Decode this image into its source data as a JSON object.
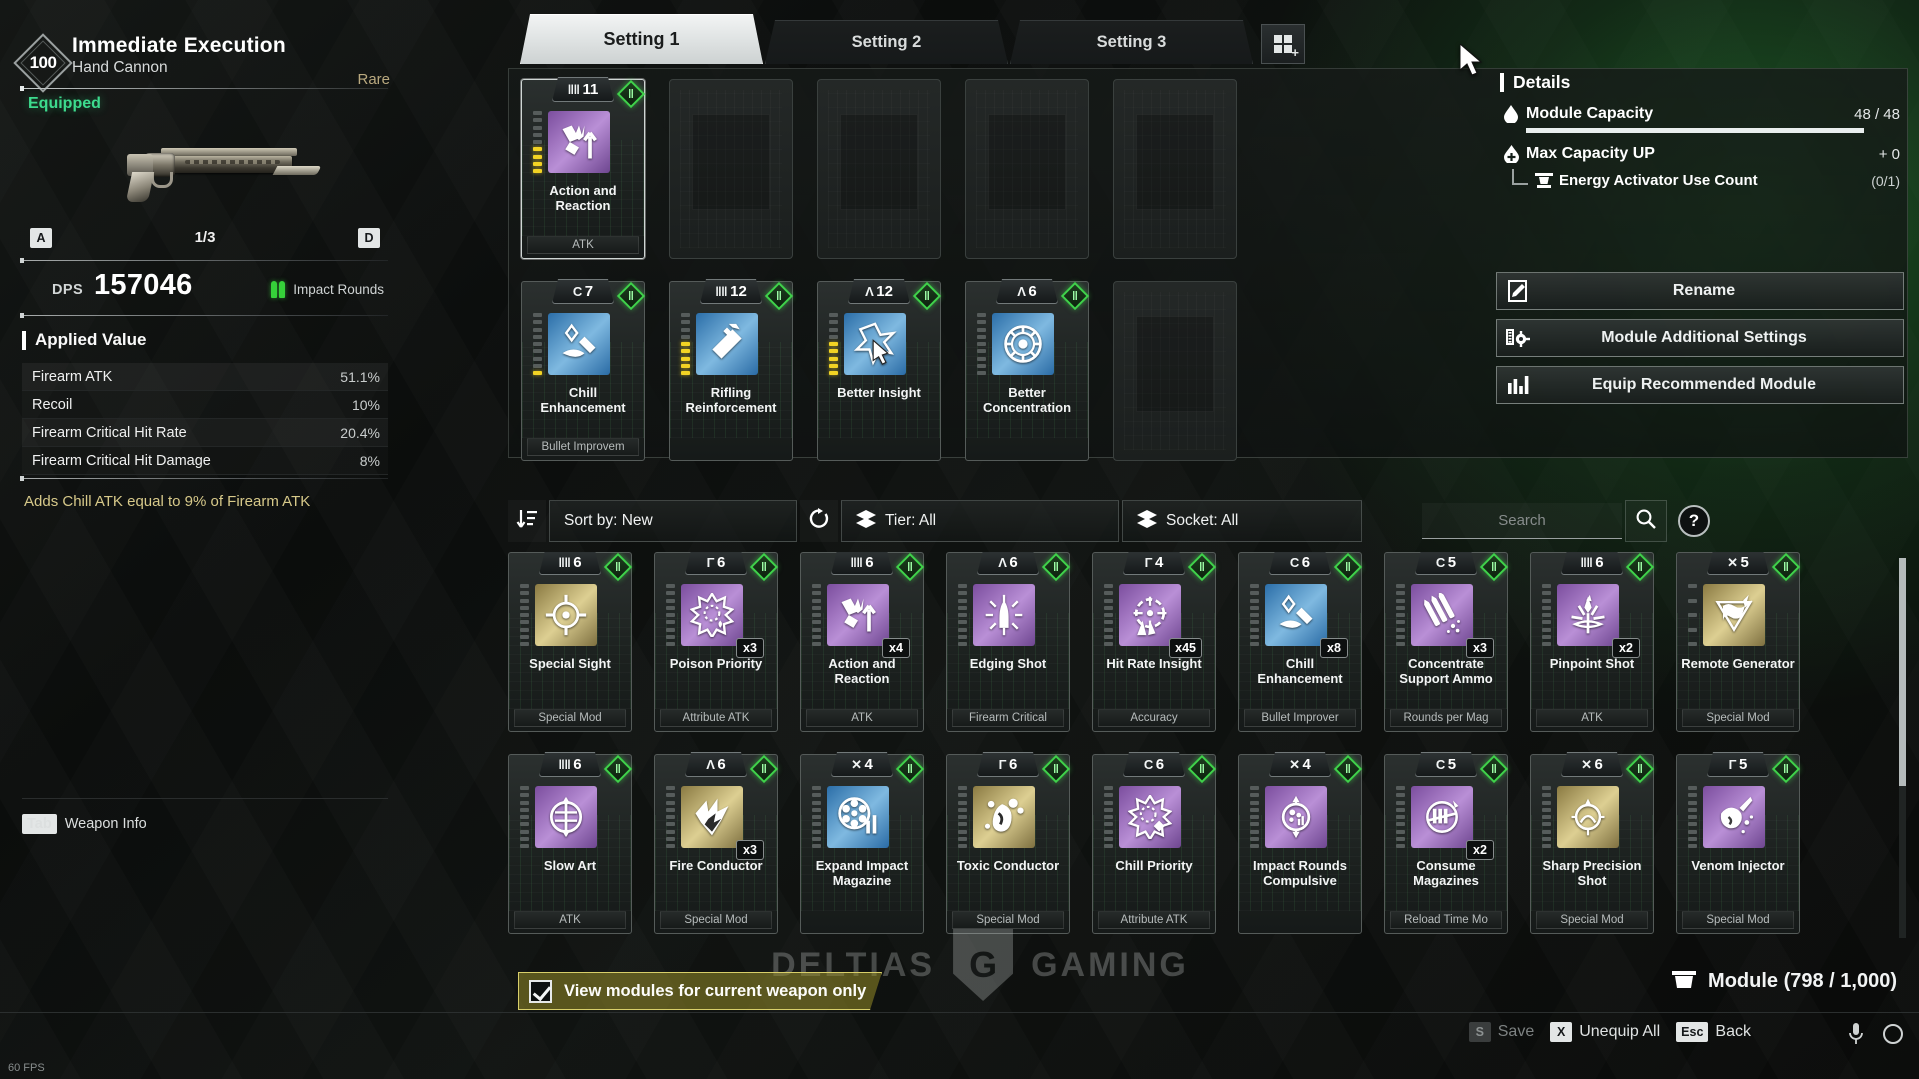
{
  "weapon": {
    "level": "100",
    "name": "Immediate Execution",
    "type": "Hand Cannon",
    "rarity": "Rare",
    "status": "Equipped",
    "page": "1/3",
    "prev_key": "A",
    "next_key": "D",
    "dps_label": "DPS",
    "dps_value": "157046",
    "ammo_type": "Impact Rounds",
    "applied_value_title": "Applied Value",
    "stats": [
      {
        "name": "Firearm ATK",
        "value": "51.1%"
      },
      {
        "name": "Recoil",
        "value": "10%"
      },
      {
        "name": "Firearm Critical Hit Rate",
        "value": "20.4%"
      },
      {
        "name": "Firearm Critical Hit Damage",
        "value": "8%"
      }
    ],
    "effect": "Adds Chill ATK equal to 9% of Firearm ATK",
    "weapon_info_key": "Tab",
    "weapon_info_label": "Weapon Info"
  },
  "tabs": [
    {
      "label": "Setting 1",
      "active": true
    },
    {
      "label": "Setting 2",
      "active": false
    },
    {
      "label": "Setting 3",
      "active": false
    }
  ],
  "tab_add_icon": "add-grid-icon",
  "equipped_modules": [
    {
      "cost_symbol": "‖‖",
      "cost": "11",
      "name": "Action and Reaction",
      "category": "ATK",
      "color": "purple",
      "icon": "action-reaction-icon",
      "pins_on": 4,
      "pins_total": 9,
      "empty": false,
      "selected": true
    },
    {
      "empty": true
    },
    {
      "empty": true
    },
    {
      "empty": true
    },
    {
      "empty": true
    },
    {
      "cost_symbol": "C",
      "cost": "7",
      "name": "Chill Enhancement",
      "category": "Bullet Improvem",
      "color": "blue",
      "icon": "chill-enhancement-icon",
      "pins_on": 1,
      "pins_total": 9,
      "empty": false,
      "selected": false
    },
    {
      "cost_symbol": "‖‖",
      "cost": "12",
      "name": "Rifling Reinforcement",
      "category": "",
      "color": "blue",
      "icon": "rifling-icon",
      "pins_on": 5,
      "pins_total": 9,
      "empty": false,
      "selected": false
    },
    {
      "cost_symbol": "Λ",
      "cost": "12",
      "name": "Better Insight",
      "category": "",
      "color": "blue",
      "icon": "better-insight-icon",
      "pins_on": 5,
      "pins_total": 9,
      "empty": false,
      "selected": false
    },
    {
      "cost_symbol": "Λ",
      "cost": "6",
      "name": "Better Concentration",
      "category": "",
      "color": "blue",
      "icon": "better-concentration-icon",
      "pins_on": 0,
      "pins_total": 9,
      "empty": false,
      "selected": false
    },
    {
      "empty": true
    }
  ],
  "details": {
    "title": "Details",
    "module_capacity_label": "Module Capacity",
    "module_capacity_value": "48 / 48",
    "module_capacity_pct": 100,
    "max_capacity_label": "Max Capacity UP",
    "max_capacity_value": "+ 0",
    "energy_activator_label": "Energy Activator Use Count",
    "energy_activator_value": "(0/1)",
    "buttons": [
      {
        "label": "Rename",
        "icon": "pencil-note-icon"
      },
      {
        "label": "Module Additional Settings",
        "icon": "module-gear-icon"
      },
      {
        "label": "Equip Recommended Module",
        "icon": "bar-chart-icon"
      }
    ]
  },
  "filterbar": {
    "sort_icon": "sort-desc-icon",
    "sort_label": "Sort by: New",
    "reset_icon": "reset-icon",
    "tier_icon": "layers-icon",
    "tier_label": "Tier: All",
    "socket_icon": "layers-icon",
    "socket_label": "Socket: All",
    "search_placeholder": "Search",
    "search_value": "",
    "search_icon": "magnifier-icon",
    "help_label": "?"
  },
  "inventory_modules": [
    {
      "cost_symbol": "‖‖",
      "cost": "6",
      "name": "Special Sight",
      "category": "Special Mod",
      "color": "gold",
      "icon": "crosshair-icon",
      "qty": "",
      "pins_on": 0,
      "pins_total": 9
    },
    {
      "cost_symbol": "Γ",
      "cost": "6",
      "name": "Poison Priority",
      "category": "Attribute ATK",
      "color": "purple",
      "icon": "poison-burst-icon",
      "qty": "x3",
      "pins_on": 0,
      "pins_total": 9
    },
    {
      "cost_symbol": "‖‖",
      "cost": "6",
      "name": "Action and Reaction",
      "category": "ATK",
      "color": "purple",
      "icon": "action-reaction-icon",
      "qty": "x4",
      "pins_on": 0,
      "pins_total": 9
    },
    {
      "cost_symbol": "Λ",
      "cost": "6",
      "name": "Edging Shot",
      "category": "Firearm Critical",
      "color": "purple",
      "icon": "edging-shot-icon",
      "qty": "",
      "pins_on": 0,
      "pins_total": 9
    },
    {
      "cost_symbol": "Γ",
      "cost": "4",
      "name": "Hit Rate Insight",
      "category": "Accuracy",
      "color": "purple",
      "icon": "hit-rate-icon",
      "qty": "x45",
      "pins_on": 0,
      "pins_total": 9
    },
    {
      "cost_symbol": "C",
      "cost": "6",
      "name": "Chill Enhancement",
      "category": "Bullet Improver",
      "color": "blue",
      "icon": "chill-enhancement-icon",
      "qty": "x8",
      "pins_on": 0,
      "pins_total": 9
    },
    {
      "cost_symbol": "C",
      "cost": "5",
      "name": "Concentrate Support Ammo",
      "category": "Rounds per Mag",
      "color": "purple",
      "icon": "support-ammo-icon",
      "qty": "x3",
      "pins_on": 0,
      "pins_total": 9
    },
    {
      "cost_symbol": "‖‖",
      "cost": "6",
      "name": "Pinpoint Shot",
      "category": "ATK",
      "color": "purple",
      "icon": "pinpoint-icon",
      "qty": "x2",
      "pins_on": 0,
      "pins_total": 9
    },
    {
      "cost_symbol": "✕",
      "cost": "5",
      "name": "Remote Generator",
      "category": "Special Mod",
      "color": "gold",
      "icon": "remote-generator-icon",
      "qty": "",
      "pins_on": 0,
      "pins_total": 5
    },
    {
      "cost_symbol": "‖‖",
      "cost": "6",
      "name": "Slow Art",
      "category": "ATK",
      "color": "purple",
      "icon": "slow-art-icon",
      "qty": "",
      "pins_on": 0,
      "pins_total": 9
    },
    {
      "cost_symbol": "Λ",
      "cost": "6",
      "name": "Fire Conductor",
      "category": "Special Mod",
      "color": "gold",
      "icon": "fire-conductor-icon",
      "qty": "x3",
      "pins_on": 0,
      "pins_total": 9
    },
    {
      "cost_symbol": "✕",
      "cost": "4",
      "name": "Expand Impact Magazine",
      "category": "",
      "color": "blue",
      "icon": "expand-magazine-icon",
      "qty": "",
      "pins_on": 0,
      "pins_total": 9
    },
    {
      "cost_symbol": "Γ",
      "cost": "6",
      "name": "Toxic Conductor",
      "category": "Special Mod",
      "color": "gold",
      "icon": "toxic-conductor-icon",
      "qty": "",
      "pins_on": 0,
      "pins_total": 9
    },
    {
      "cost_symbol": "C",
      "cost": "6",
      "name": "Chill Priority",
      "category": "Attribute ATK",
      "color": "purple",
      "icon": "chill-priority-icon",
      "qty": "",
      "pins_on": 0,
      "pins_total": 9
    },
    {
      "cost_symbol": "✕",
      "cost": "4",
      "name": "Impact Rounds Compulsive",
      "category": "",
      "color": "purple",
      "icon": "impact-rounds-icon",
      "qty": "",
      "pins_on": 0,
      "pins_total": 9
    },
    {
      "cost_symbol": "C",
      "cost": "5",
      "name": "Consume Magazines",
      "category": "Reload Time Mo",
      "color": "purple",
      "icon": "consume-magazines-icon",
      "qty": "x2",
      "pins_on": 0,
      "pins_total": 9
    },
    {
      "cost_symbol": "✕",
      "cost": "6",
      "name": "Sharp Precision Shot",
      "category": "Special Mod",
      "color": "gold",
      "icon": "sharp-precision-icon",
      "qty": "",
      "pins_on": 0,
      "pins_total": 9
    },
    {
      "cost_symbol": "Γ",
      "cost": "5",
      "name": "Venom Injector",
      "category": "Special Mod",
      "color": "purple",
      "icon": "venom-injector-icon",
      "qty": "",
      "pins_on": 0,
      "pins_total": 9
    }
  ],
  "bottom": {
    "view_toggle_label": "View modules for current weapon only",
    "view_toggle_checked": true,
    "module_count_label": "Module (798 / 1,000)",
    "module_count_icon": "box-icon",
    "keys": [
      {
        "key": "S",
        "label": "Save",
        "dim": true
      },
      {
        "key": "X",
        "label": "Unequip All",
        "dim": false
      },
      {
        "key": "Esc",
        "label": "Back",
        "dim": false
      }
    ],
    "mic_icon": "microphone-icon",
    "refresh_icon": "circle-icon",
    "fps": "60 FPS"
  },
  "watermark": {
    "left": "DELTIAS",
    "right": "GAMING"
  },
  "colors": {
    "accent_green": "#3ddb8e",
    "socket_green": "#3fd24a",
    "gold_text": "#d7c98a",
    "toggle_yellow": "#d8cf6a"
  }
}
